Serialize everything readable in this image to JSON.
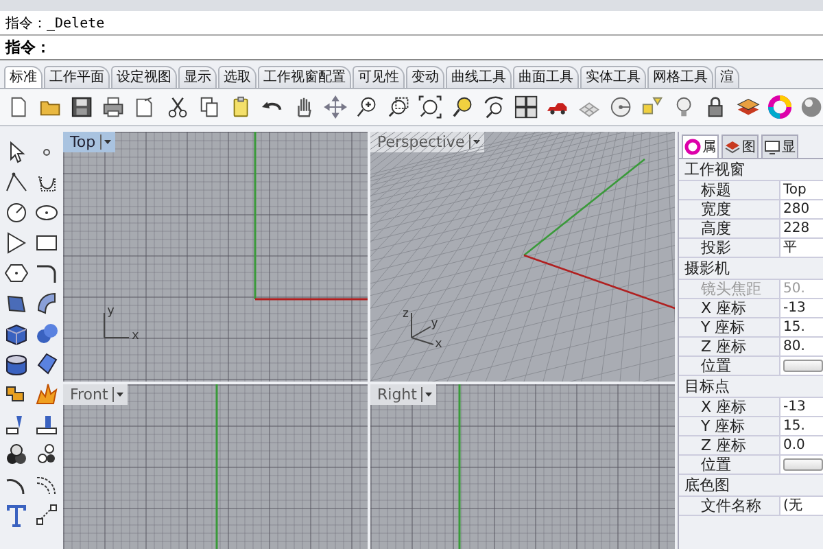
{
  "command_history": {
    "text": "指令：_Delete"
  },
  "command_line": {
    "prompt": "指令："
  },
  "tabs": [
    {
      "label": "标准",
      "selected": true
    },
    {
      "label": "工作平面",
      "selected": false
    },
    {
      "label": "设定视图",
      "selected": false
    },
    {
      "label": "显示",
      "selected": false
    },
    {
      "label": "选取",
      "selected": false
    },
    {
      "label": "工作视窗配置",
      "selected": false
    },
    {
      "label": "可见性",
      "selected": false
    },
    {
      "label": "变动",
      "selected": false
    },
    {
      "label": "曲线工具",
      "selected": false
    },
    {
      "label": "曲面工具",
      "selected": false
    },
    {
      "label": "实体工具",
      "selected": false
    },
    {
      "label": "网格工具",
      "selected": false
    },
    {
      "label": "渲",
      "selected": false
    }
  ],
  "viewports": [
    {
      "title": "Top",
      "selected": true,
      "kind": "parallel",
      "axis_labels": [
        "y",
        "x"
      ]
    },
    {
      "title": "Perspective",
      "selected": false,
      "kind": "perspective",
      "axis_labels": [
        "z",
        "y",
        "x"
      ]
    },
    {
      "title": "Front",
      "selected": false,
      "kind": "parallel"
    },
    {
      "title": "Right",
      "selected": false,
      "kind": "parallel"
    }
  ],
  "panel_tabs": [
    {
      "label": "属",
      "selected": true
    },
    {
      "label": "图",
      "selected": false
    },
    {
      "label": "显",
      "selected": false
    }
  ],
  "properties": [
    {
      "title": "工作视窗",
      "rows": [
        {
          "label": "标题",
          "kind": "text",
          "value": "Top",
          "disabled": false
        },
        {
          "label": "宽度",
          "kind": "text",
          "value": "280",
          "disabled": false
        },
        {
          "label": "高度",
          "kind": "text",
          "value": "228",
          "disabled": false
        },
        {
          "label": "投影",
          "kind": "text",
          "value": "平",
          "disabled": false
        }
      ]
    },
    {
      "title": "摄影机",
      "rows": [
        {
          "label": "镜头焦距",
          "kind": "text",
          "value": "50.",
          "disabled": true
        },
        {
          "label": "X 座标",
          "kind": "text",
          "value": "-13",
          "disabled": false
        },
        {
          "label": "Y 座标",
          "kind": "text",
          "value": "15.",
          "disabled": false
        },
        {
          "label": "Z 座标",
          "kind": "text",
          "value": "80.",
          "disabled": false
        },
        {
          "label": "位置",
          "kind": "button",
          "disabled": false
        }
      ]
    },
    {
      "title": "目标点",
      "rows": [
        {
          "label": "X 座标",
          "kind": "text",
          "value": "-13",
          "disabled": false
        },
        {
          "label": "Y 座标",
          "kind": "text",
          "value": "15.",
          "disabled": false
        },
        {
          "label": "Z 座标",
          "kind": "text",
          "value": "0.0",
          "disabled": false
        },
        {
          "label": "位置",
          "kind": "button",
          "disabled": false
        }
      ]
    },
    {
      "title": "底色图",
      "rows": [
        {
          "label": "文件名称",
          "kind": "text",
          "value": "(无",
          "disabled": false
        }
      ]
    }
  ]
}
